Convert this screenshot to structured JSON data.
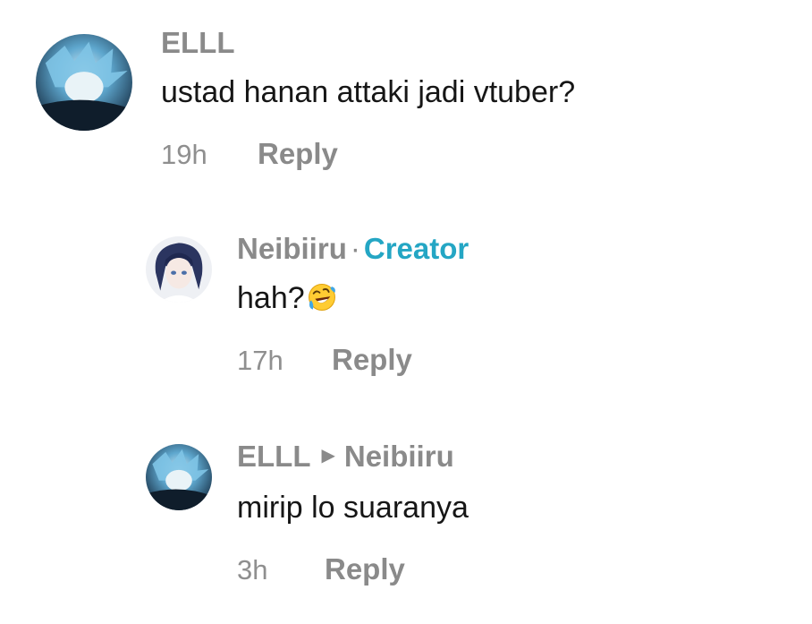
{
  "comments": [
    {
      "author": "ELLL",
      "text": "ustad hanan attaki jadi vtuber?",
      "time": "19h",
      "reply_label": "Reply"
    },
    {
      "author": "Neibiiru",
      "separator": "·",
      "badge": "Creator",
      "text": "hah?",
      "emoji": "rolling-on-the-floor-laughing-emoji",
      "time": "17h",
      "reply_label": "Reply"
    },
    {
      "author": "ELLL",
      "reply_to": "Neibiiru",
      "text": "mirip lo suaranya",
      "time": "3h",
      "reply_label": "Reply"
    }
  ],
  "colors": {
    "author": "#8a8a8a",
    "creator_badge": "#24a6c4",
    "body_text": "#161616",
    "meta": "#8f8f8f"
  }
}
